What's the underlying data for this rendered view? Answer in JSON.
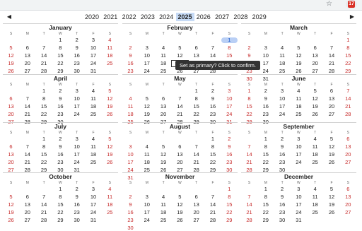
{
  "browser": {
    "star_icon": "star-outline-icon",
    "extension_badge": "17"
  },
  "nav": {
    "prev": "◀",
    "next": "▶"
  },
  "years": [
    "2020",
    "2021",
    "2022",
    "2023",
    "2024",
    "2025",
    "2026",
    "2027",
    "2028",
    "2029"
  ],
  "selected_year": "2025",
  "weekdays": [
    "S",
    "M",
    "T",
    "W",
    "T",
    "F",
    "S"
  ],
  "months": [
    {
      "name": "January",
      "start": 3,
      "days": 31
    },
    {
      "name": "February",
      "start": 6,
      "days": 28
    },
    {
      "name": "March",
      "start": 6,
      "days": 31
    },
    {
      "name": "April",
      "start": 2,
      "days": 30
    },
    {
      "name": "May",
      "start": 4,
      "days": 31
    },
    {
      "name": "June",
      "start": 0,
      "days": 30
    },
    {
      "name": "July",
      "start": 2,
      "days": 31
    },
    {
      "name": "August",
      "start": 5,
      "days": 31
    },
    {
      "name": "September",
      "start": 1,
      "days": 30
    },
    {
      "name": "October",
      "start": 3,
      "days": 31
    },
    {
      "name": "November",
      "start": 6,
      "days": 30
    },
    {
      "name": "December",
      "start": 1,
      "days": 31
    }
  ],
  "today": {
    "month": 1,
    "day": 1
  },
  "selected": {
    "month": 1,
    "day": 19
  },
  "tooltip": "Set as primary? Click to confirm.",
  "colors": {
    "weekend": "#c62828",
    "highlight": "#b9cff5",
    "year_selected": "#c6daf5"
  }
}
